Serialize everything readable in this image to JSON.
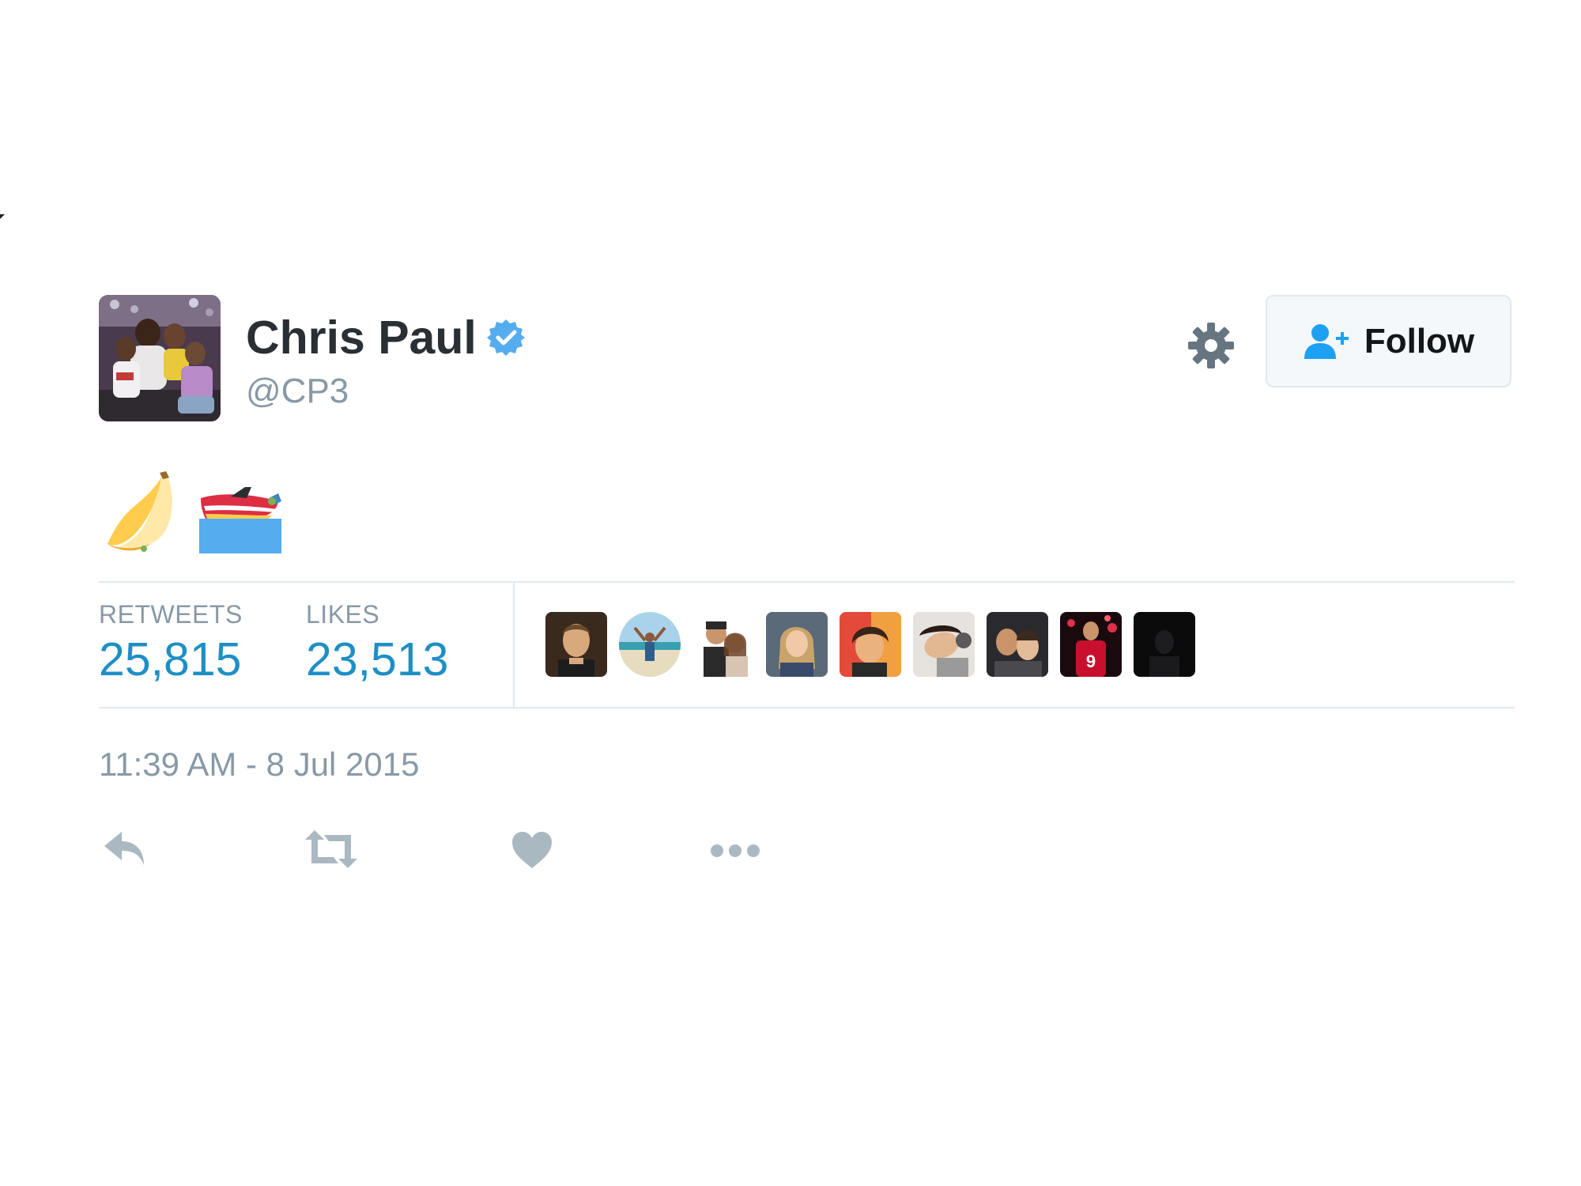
{
  "tweet": {
    "author": {
      "display_name": "Chris Paul",
      "handle": "@CP3",
      "verified_icon": "verified-badge-icon",
      "verified_color": "#55acee"
    },
    "follow_label": "Follow",
    "settings_icon": "gear-icon",
    "body_emojis": [
      "banana-emoji",
      "speedboat-emoji"
    ],
    "stats": {
      "retweets_label": "RETWEETS",
      "retweets_count": "25,815",
      "likes_label": "LIKES",
      "likes_count": "23,513"
    },
    "liker_avatar_count": 9,
    "timestamp": "11:39 AM - 8 Jul 2015",
    "actions": [
      "reply-icon",
      "retweet-icon",
      "like-icon",
      "more-icon"
    ]
  },
  "colors": {
    "accent": "#1e8fc5",
    "muted": "#8899a6",
    "text": "#292f33",
    "border": "#e1e8ed"
  }
}
